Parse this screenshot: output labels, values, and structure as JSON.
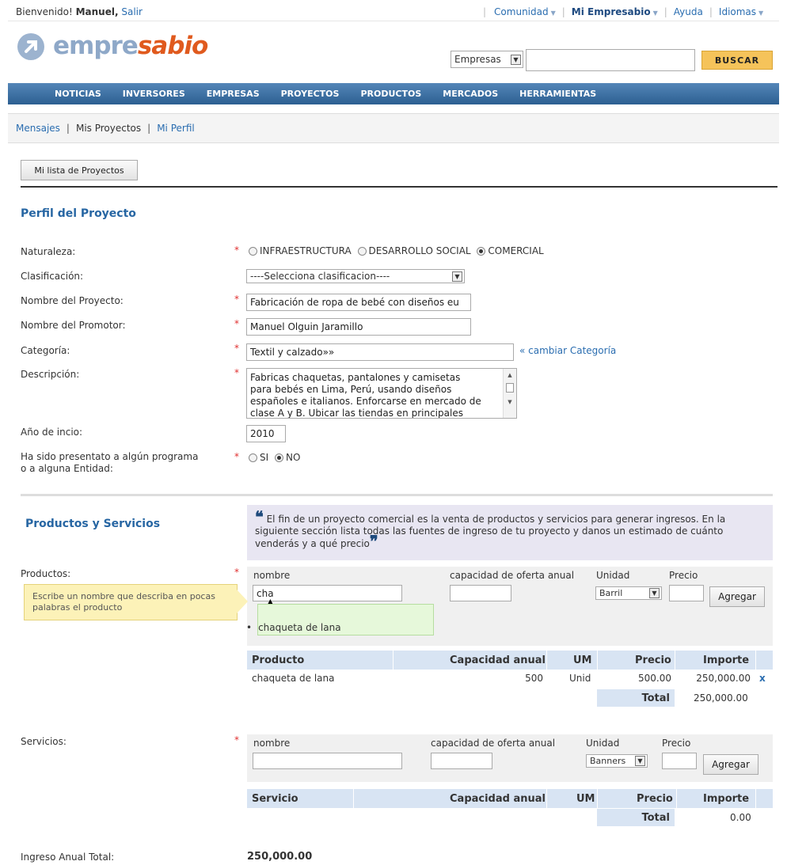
{
  "header": {
    "welcome": "Bienvenido!",
    "user": "Manuel,",
    "logout": "Salir",
    "menu": [
      {
        "label": "Comunidad",
        "bold": false
      },
      {
        "label": "Mi Empresabio",
        "bold": true
      },
      {
        "label": "Ayuda",
        "bold": false
      },
      {
        "label": "Idiomas",
        "bold": false
      }
    ]
  },
  "logo": {
    "part1": "empre",
    "part2": "sabio"
  },
  "search": {
    "scope": "Empresas",
    "query": "",
    "button": "BUSCAR"
  },
  "nav": [
    "NOTICIAS",
    "INVERSORES",
    "EMPRESAS",
    "PROYECTOS",
    "PRODUCTOS",
    "MERCADOS",
    "HERRAMIENTAS"
  ],
  "subnav": {
    "mensajes": "Mensajes",
    "proyectos": "Mis Proyectos",
    "perfil": "Mi Perfil",
    "sep": "|"
  },
  "list_button": "Mi lista de Proyectos",
  "perfil": {
    "title": "Perfil del Proyecto",
    "naturaleza_label": "Naturaleza:",
    "naturaleza_options": [
      "INFRAESTRUCTURA",
      "DESARROLLO SOCIAL",
      "COMERCIAL"
    ],
    "clasificacion_label": "Clasificación:",
    "clasificacion_value": "----Selecciona clasificacion----",
    "nombre_label": "Nombre del Proyecto:",
    "nombre_value": "Fabricación de ropa de bebé con diseños eu",
    "promotor_label": "Nombre del Promotor:",
    "promotor_value": "Manuel Olguin Jaramillo",
    "categoria_label": "Categoría:",
    "categoria_value": "Textil y calzado»»",
    "cambiar": "« cambiar Categoría",
    "descripcion_label": "Descripción:",
    "descripcion_lines": [
      "Fabricas chaquetas, pantalones y camisetas",
      "para bebés en Lima, Perú, usando diseños",
      "españoles e italianos. Enforcarse en mercado de",
      "clase A y B. Ubicar las tiendas en principales"
    ],
    "anio_label": "Año de incio:",
    "anio_value": "2010",
    "programa_label_1": "Ha sido presentato a algún programa",
    "programa_label_2": "o a alguna Entidad:",
    "programa_si": "SI",
    "programa_no": "NO",
    "required": "*"
  },
  "productos": {
    "title": "Productos y Servicios",
    "quote": "El fin de un proyecto comercial es la venta de productos y servicios para generar ingresos. En la siguiente sección lista todas las fuentes de ingreso de tu proyecto y danos un estimado de cuánto venderás y a qué precio",
    "label": "Productos:",
    "col_nombre": "nombre",
    "col_capacidad": "capacidad de oferta anual",
    "col_unidad": "Unidad",
    "col_precio": "Precio",
    "input_nombre": "cha",
    "unidad_value": "Barril",
    "agregar": "Agregar",
    "tooltip": "Escribe un nombre que describa en pocas palabras el producto",
    "suggestion": "chaqueta de lana",
    "table_headers": [
      "Producto",
      "Capacidad anual",
      "UM",
      "Precio",
      "Importe"
    ],
    "row": {
      "nombre": "chaqueta de lana",
      "capacidad": "500",
      "um": "Unid",
      "precio": "500.00",
      "importe": "250,000.00"
    },
    "remove": "x",
    "total_label": "Total",
    "total_value": "250,000.00"
  },
  "servicios": {
    "label": "Servicios:",
    "col_nombre": "nombre",
    "col_capacidad": "capacidad de oferta anual",
    "col_unidad": "Unidad",
    "col_precio": "Precio",
    "unidad_value": "Banners",
    "agregar": "Agregar",
    "table_headers": [
      "Servicio",
      "Capacidad anual",
      "UM",
      "Precio",
      "Importe"
    ],
    "total_label": "Total",
    "total_value": "0.00"
  },
  "ingreso": {
    "label": "Ingreso Anual Total:",
    "value": "250,000.00"
  },
  "colors": {
    "link": "#2a6db0",
    "nav": "#2c5f91",
    "accent": "#e05a1e",
    "button": "#f5c35a"
  }
}
